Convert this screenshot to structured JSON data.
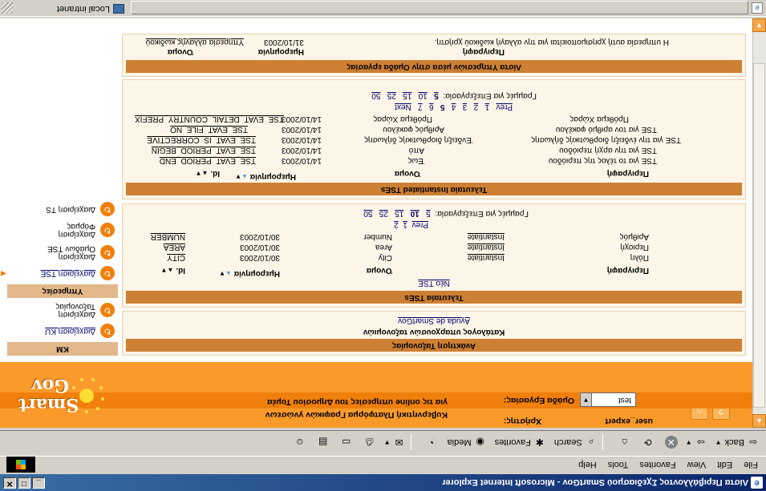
{
  "window": {
    "title": "Λίστα Περιβάλλοντος Σχεδιασμού SmartGov - Microsoft Internet Explorer",
    "icon": "ie-icon"
  },
  "menubar": {
    "items": [
      "File",
      "Edit",
      "View",
      "Favorites",
      "Tools",
      "Help"
    ]
  },
  "toolbar": {
    "back": "Back",
    "search": "Search",
    "favorites": "Favorites",
    "media": "Media"
  },
  "header": {
    "user_label": "Χρήστης:",
    "user_value": "user_expert",
    "workgroup_label": "Ομάδα Εργασίας:",
    "workgroup_value": "test",
    "tagline1": "Κυβερνητική Πλατφόρμα Γραφικών γνώσεων",
    "tagline2": "για τις online υπηρεσίες του Δημοσίου Τομέα",
    "logo_text1": "Smart",
    "logo_text2": "Gov"
  },
  "sidebar": {
    "km_header": "KM",
    "km_items": [
      {
        "label1": "Διαχείριση KU",
        "link": true
      },
      {
        "label1": "Διαχείριση",
        "label2": "Ταξονομίας"
      }
    ],
    "services_header": "Υπηρεσίες",
    "service_items": [
      {
        "label1": "Διαχείριση TSE",
        "link": true,
        "current": true
      },
      {
        "label1": "Διαχείριση",
        "label2": "Ομάδων TSE"
      },
      {
        "label1": "Διαχείριση",
        "label2": "Φόρμας"
      },
      {
        "label1": "Διαχείριση TS"
      }
    ]
  },
  "taxonomy": {
    "title": "Ανάκτηση Ταξονομίας",
    "catalog": "Κατάλογος υπαρχουσών ταξονομιών",
    "link": "Ayuda de SmartGov"
  },
  "tses": {
    "title": "Τελευταία TSEs",
    "new_link": "Νέο TSE",
    "headers": [
      "Id.",
      "Ημερομηνία",
      "Όνομα",
      "",
      "Περιγραφή"
    ],
    "rows": [
      {
        "id": "CITY",
        "date": "30/10/2003",
        "name": "City",
        "type": "Instantiate",
        "desc": "Πόλη"
      },
      {
        "id": "AREA",
        "date": "30/10/2003",
        "name": "Area",
        "type": "Instantiate",
        "desc": "Περιοχή"
      },
      {
        "id": "NUMBER",
        "date": "30/10/2003",
        "name": "Number",
        "type": "Instantiate",
        "desc": "Αριθμός"
      }
    ],
    "prev": "Prev",
    "pages": [
      "1",
      "2"
    ],
    "rows_label": "Γραμμές για Επεξεργασία:",
    "rows_options": [
      "5",
      "10",
      "15",
      "25",
      "50"
    ],
    "rows_selected": "10"
  },
  "instantiated": {
    "title": "Τελευταία Instantiated TSEs",
    "headers": [
      "Id.",
      "Ημερομηνία",
      "Όνομα",
      "Περιγραφή"
    ],
    "rows": [
      {
        "id": "TSE_EVAT_PERIOD_END",
        "date": "14/10/2003",
        "name": "Έως",
        "desc": "TSE για το τέλος της περιόδου"
      },
      {
        "id": "TSE_EVAT_PERIOD_BEGIN",
        "date": "14/10/2003",
        "name": "Από",
        "desc": "TSE για την αρχή περιόδου"
      },
      {
        "id": "TSE_EVAT_IS_CORRECTIVE",
        "date": "14/10/2003",
        "name": "Ένδειξη διορθωτικής δήλωσης",
        "desc": "TSE για την ένδειξη διορθωτικής δήλωσης"
      },
      {
        "id": "TSE_EVAT_FILE_NO",
        "date": "14/10/2003",
        "name": "Αριθμός φακέλου",
        "desc": "TSE για τον αριθμό φακέλου"
      },
      {
        "id": "TSE_EVAT_DETAIL_COUNTRY_PREFIX",
        "date": "14/10/2003",
        "name": "Πρόθεμα Χώρας",
        "desc": "Πρόθεμα Χώρας"
      }
    ],
    "prev": "Prev",
    "pages": [
      "1",
      "2",
      "3",
      "4",
      "5",
      "6",
      "7"
    ],
    "current_page": "5",
    "next": "Next",
    "rows_label": "Γραμμές για Επεξεργασία:",
    "rows_options": [
      "5",
      "10",
      "15",
      "25",
      "50"
    ],
    "rows_selected": "5"
  },
  "group_services": {
    "title": "Λίστα Υπηρεσιών μέσα στην Ομάδα εργασίας",
    "headers": [
      "Όνομα",
      "Ημερομηνία",
      "Περιγραφή"
    ],
    "rows": [
      {
        "name": "Υπηρεσία αλλαγής κωδικού",
        "date": "31/10/2003",
        "desc": "Η υπηρεσία αυτή χρησιμοποιείται για την αλλαγή κωδικού χρήστη."
      }
    ]
  },
  "status": {
    "zone": "Local intranet"
  },
  "colors": {
    "orange": "#fa9a2a",
    "dark_orange": "#f07f0c",
    "panel_header": "#cd7f33",
    "link": "#00006a"
  }
}
